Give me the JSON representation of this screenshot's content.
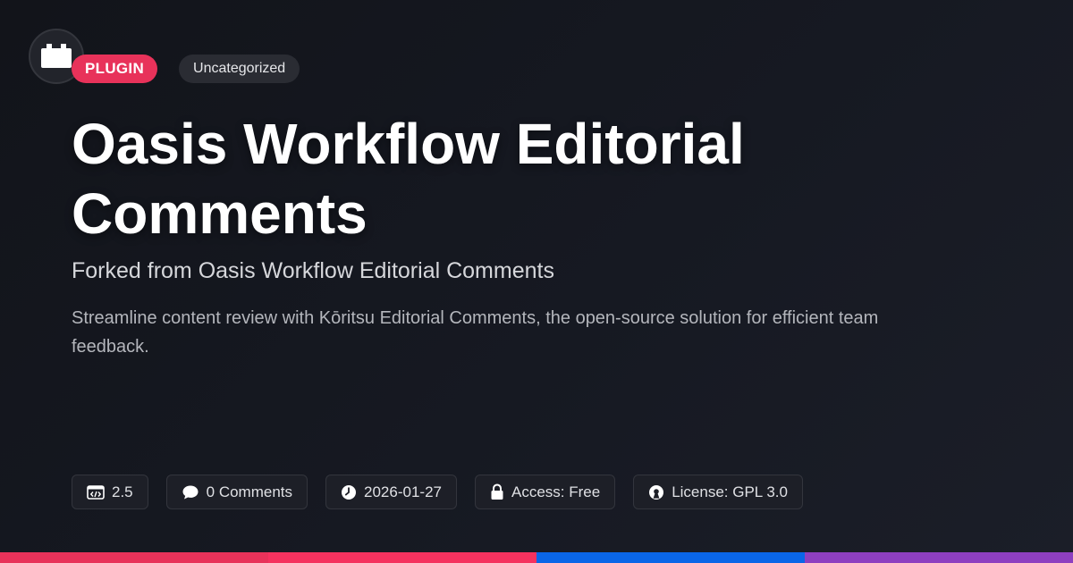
{
  "badges": {
    "type_label": "PLUGIN",
    "category_label": "Uncategorized"
  },
  "title": "Oasis Workflow Editorial Comments",
  "subtitle": "Forked from Oasis Workflow Editorial Comments",
  "description": "Streamline content review with Kōritsu Editorial Comments, the open-source solution for efficient team feedback.",
  "meta": {
    "version": "2.5",
    "comments": "0 Comments",
    "date": "2026-01-27",
    "access": "Access: Free",
    "license": "License: GPL 3.0"
  },
  "icons": {
    "logo": "plugin-block-icon",
    "version": "code-window-icon",
    "comments": "speech-bubble-icon",
    "date": "clock-icon",
    "access": "lock-icon",
    "license": "open-source-icon"
  },
  "colors": {
    "accent": "#e8325a",
    "background": "#13151c",
    "bar_segments": [
      "#e8325a",
      "#f5325f",
      "#0a66e8",
      "#8e3fc0"
    ]
  }
}
